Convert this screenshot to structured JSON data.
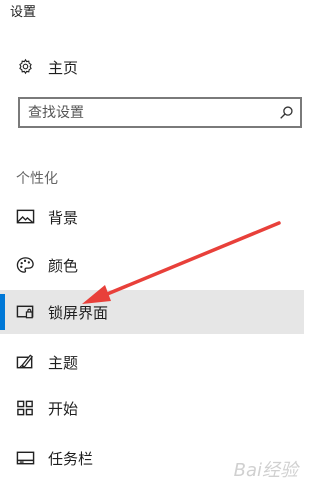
{
  "app": {
    "title": "设置"
  },
  "home": {
    "label": "主页",
    "icon": "gear-icon"
  },
  "search": {
    "placeholder": "查找设置",
    "icon": "search-icon"
  },
  "section": {
    "header": "个性化"
  },
  "nav": {
    "items": [
      {
        "label": "背景",
        "icon": "picture-icon",
        "selected": false
      },
      {
        "label": "颜色",
        "icon": "palette-icon",
        "selected": false
      },
      {
        "label": "锁屏界面",
        "icon": "lock-screen-icon",
        "selected": true
      },
      {
        "label": "主题",
        "icon": "theme-brush-icon",
        "selected": false
      },
      {
        "label": "开始",
        "icon": "start-grid-icon",
        "selected": false
      },
      {
        "label": "任务栏",
        "icon": "taskbar-icon",
        "selected": false
      }
    ]
  },
  "colors": {
    "accent": "#0078d7",
    "selected_bg": "#e6e6e6",
    "annotation_arrow": "#e8403a"
  },
  "watermark": {
    "text": "Bai经验"
  }
}
